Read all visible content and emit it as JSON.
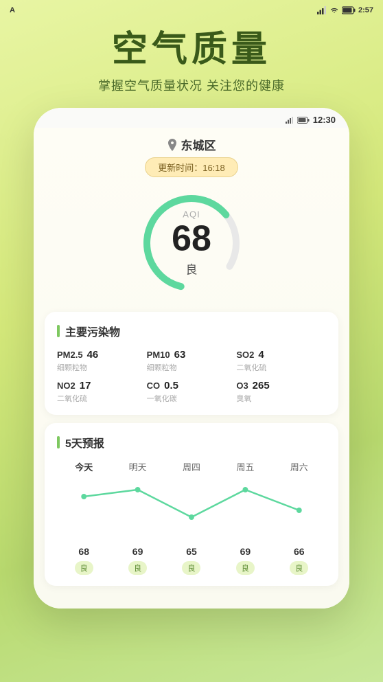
{
  "statusBar": {
    "app": "A",
    "time": "2:57",
    "phoneTime": "12:30"
  },
  "header": {
    "title": "空气质量",
    "subtitle": "掌握空气质量状况 关注您的健康"
  },
  "phone": {
    "location": "东城区",
    "updateTime": "更新时间：16:18",
    "aqi": {
      "label": "AQI",
      "value": "68",
      "quality": "良"
    },
    "pollutants": {
      "sectionTitle": "主要污染物",
      "items": [
        {
          "name": "PM2.5",
          "value": "46",
          "desc": "细颗粒物"
        },
        {
          "name": "PM10",
          "value": "63",
          "desc": "细颗粒物"
        },
        {
          "name": "SO2",
          "value": "4",
          "desc": "二氧化硫"
        },
        {
          "name": "NO2",
          "value": "17",
          "desc": "二氧化硫"
        },
        {
          "name": "CO",
          "value": "0.5",
          "desc": "一氧化碳"
        },
        {
          "name": "O3",
          "value": "265",
          "desc": "臭氧"
        }
      ]
    },
    "forecast": {
      "sectionTitle": "5天预报",
      "days": [
        {
          "label": "今天",
          "value": "68",
          "quality": "良",
          "today": true
        },
        {
          "label": "明天",
          "value": "69",
          "quality": "良",
          "today": false
        },
        {
          "label": "周四",
          "value": "65",
          "quality": "良",
          "today": false
        },
        {
          "label": "周五",
          "value": "69",
          "quality": "良",
          "today": false
        },
        {
          "label": "周六",
          "value": "66",
          "quality": "良",
          "today": false
        }
      ]
    }
  }
}
